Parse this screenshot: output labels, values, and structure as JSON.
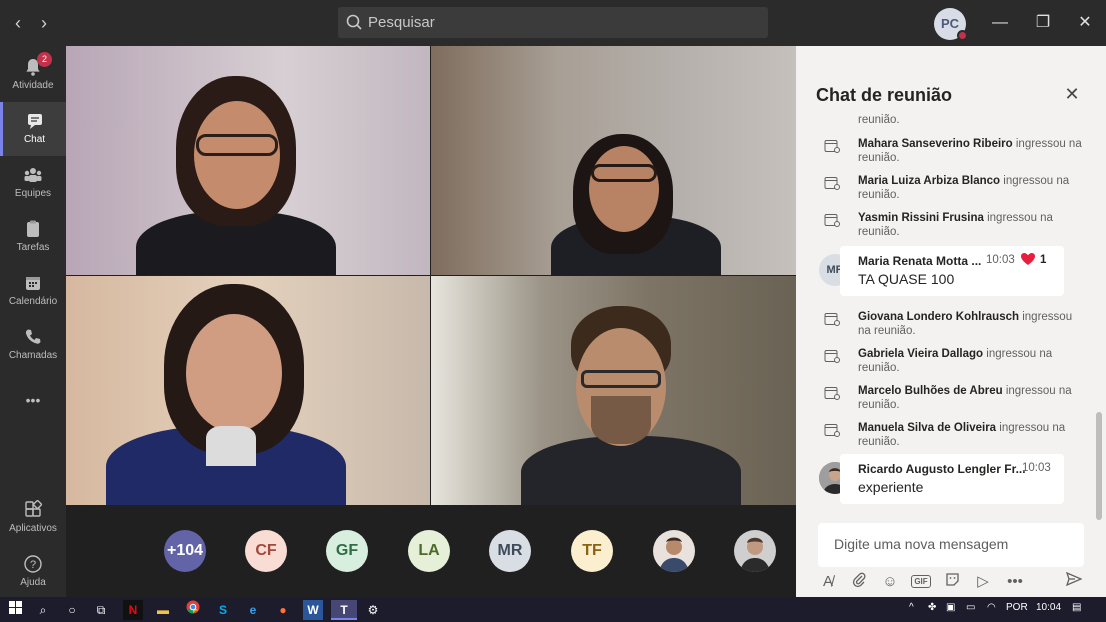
{
  "titlebar": {
    "back_icon": "chevron-left-icon",
    "forward_icon": "chevron-right-icon",
    "search_placeholder": "Pesquisar",
    "user_initials": "PC",
    "minimize": "—",
    "restore": "❐",
    "close": "✕"
  },
  "rail": {
    "items": [
      {
        "label": "Atividade",
        "icon": "bell-icon",
        "badge": "2"
      },
      {
        "label": "Chat",
        "icon": "chat-icon"
      },
      {
        "label": "Equipes",
        "icon": "teams-icon"
      },
      {
        "label": "Tarefas",
        "icon": "tasks-icon"
      },
      {
        "label": "Calendário",
        "icon": "calendar-icon"
      },
      {
        "label": "Chamadas",
        "icon": "phone-icon"
      },
      {
        "label": "•••",
        "icon": "more-icon"
      },
      {
        "label": "Aplicativos",
        "icon": "apps-icon"
      },
      {
        "label": "Ajuda",
        "icon": "help-icon"
      }
    ]
  },
  "roster": {
    "overflow": "+104",
    "participants": [
      {
        "initials": "CF",
        "bg": "#f9dcd4",
        "fg": "#a1493a"
      },
      {
        "initials": "GF",
        "bg": "#d8efe0",
        "fg": "#2f6d45"
      },
      {
        "initials": "LA",
        "bg": "#e6f0d8",
        "fg": "#4d6a2c"
      },
      {
        "initials": "MR",
        "bg": "#d9dde4",
        "fg": "#3f4a5a"
      },
      {
        "initials": "TF",
        "bg": "#fbefd0",
        "fg": "#8a6315"
      }
    ]
  },
  "chat": {
    "title": "Chat de reunião",
    "close_icon": "close-icon",
    "partial_top": "reunião.",
    "system_messages_top": [
      {
        "name": "Mahara Sanseverino Ribeiro",
        "text": " ingressou na reunião."
      },
      {
        "name": "Maria Luiza Arbiza Blanco",
        "text": " ingressou na reunião."
      },
      {
        "name": "Yasmin Rissini Frusina",
        "text": " ingressou na reunião."
      }
    ],
    "message1": {
      "initials": "MR",
      "name": "Maria Renata Motta ...",
      "time": "10:03",
      "text": "TA QUASE 100",
      "reaction_count": "1"
    },
    "system_messages_bottom": [
      {
        "name": "Giovana Londero Kohlrausch",
        "text": " ingressou na reunião."
      },
      {
        "name": "Gabriela Vieira Dallago",
        "text": " ingressou na reunião."
      },
      {
        "name": "Marcelo Bulhões de Abreu",
        "text": " ingressou na reunião."
      },
      {
        "name": "Manuela Silva de Oliveira",
        "text": " ingressou na reunião."
      }
    ],
    "message2": {
      "name": "Ricardo Augusto Lengler Fr...",
      "time": "10:03",
      "text": "experiente"
    },
    "compose_placeholder": "Digite uma nova mensagem"
  },
  "taskbar": {
    "language": "POR",
    "time": "10:04"
  },
  "colors": {
    "accent": "#7b83eb",
    "badge": "#c4314b",
    "heart": "#e81e3d",
    "overflow_avatar": "#6264a7"
  }
}
